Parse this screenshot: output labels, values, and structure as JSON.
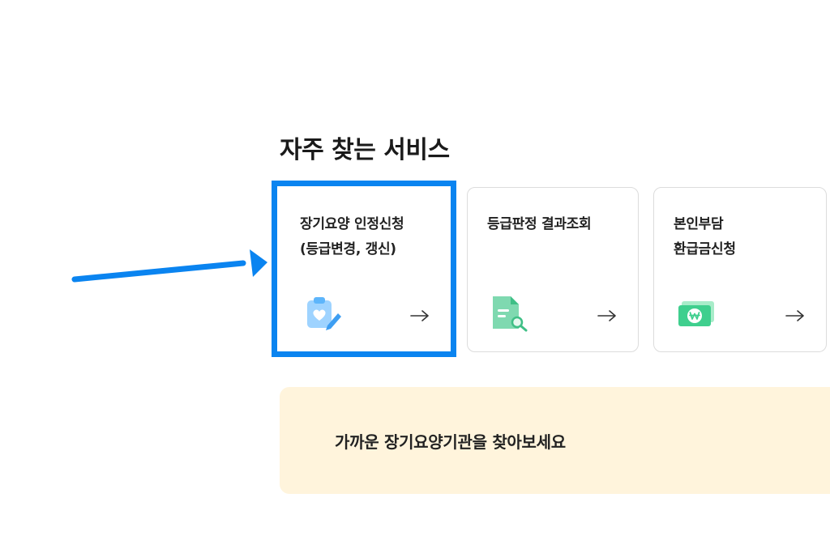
{
  "section": {
    "title": "자주 찾는 서비스"
  },
  "cards": [
    {
      "title": "장기요양 인정신청\n(등급변경, 갱신)",
      "icon": "clipboard-heart-icon"
    },
    {
      "title": "등급판정 결과조회",
      "icon": "document-search-icon"
    },
    {
      "title": "본인부담\n환급금신청",
      "icon": "won-banknote-icon"
    }
  ],
  "banner": {
    "text": "가까운 장기요양기관을 찾아보세요"
  },
  "colors": {
    "highlight": "#0a84f0",
    "banner_bg": "#fff4dc",
    "icon_blue": "#7cc4ff",
    "icon_green": "#39c98a"
  }
}
